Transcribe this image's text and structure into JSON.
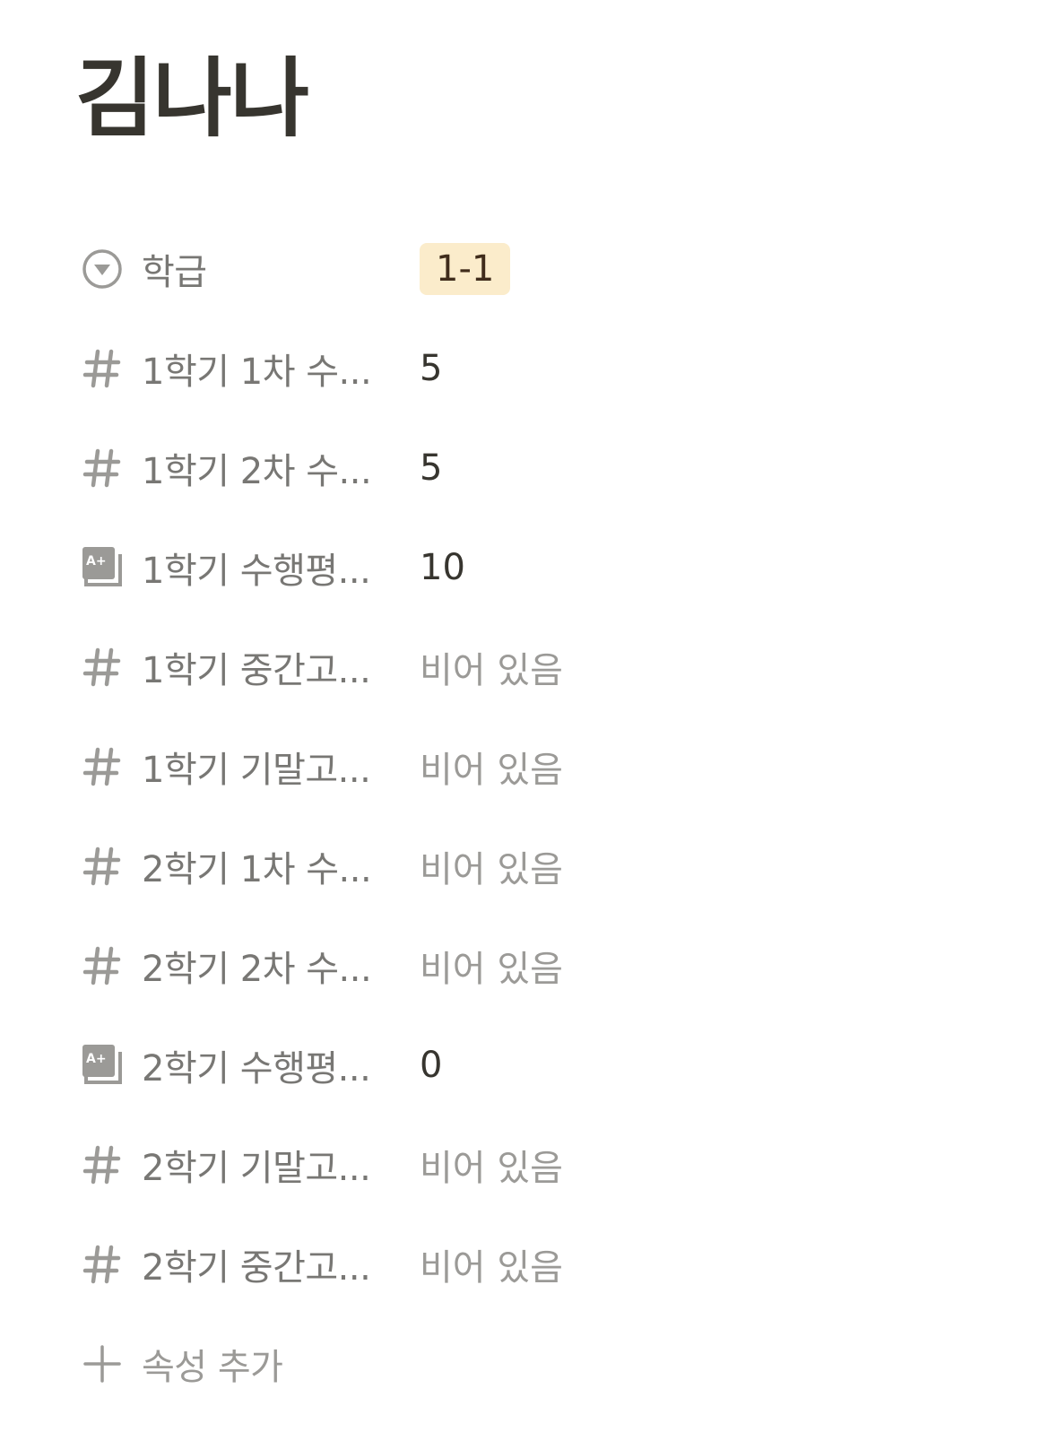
{
  "page": {
    "title": "김나나"
  },
  "properties": [
    {
      "icon": "select-icon",
      "name": "학급",
      "value": "1-1",
      "value_type": "tag",
      "tag_color": "#fbeccb"
    },
    {
      "icon": "number-icon",
      "name": "1학기 1차 수...",
      "value": "5",
      "value_type": "value"
    },
    {
      "icon": "number-icon",
      "name": "1학기 2차 수...",
      "value": "5",
      "value_type": "value"
    },
    {
      "icon": "grade-icon",
      "name": "1학기 수행평...",
      "value": "10",
      "value_type": "value"
    },
    {
      "icon": "number-icon",
      "name": "1학기 중간고...",
      "value": "비어 있음",
      "value_type": "empty"
    },
    {
      "icon": "number-icon",
      "name": "1학기 기말고...",
      "value": "비어 있음",
      "value_type": "empty"
    },
    {
      "icon": "number-icon",
      "name": "2학기 1차 수...",
      "value": "비어 있음",
      "value_type": "empty"
    },
    {
      "icon": "number-icon",
      "name": "2학기 2차 수...",
      "value": "비어 있음",
      "value_type": "empty"
    },
    {
      "icon": "grade-icon",
      "name": "2학기 수행평...",
      "value": "0",
      "value_type": "value"
    },
    {
      "icon": "number-icon",
      "name": "2학기 기말고...",
      "value": "비어 있음",
      "value_type": "empty"
    },
    {
      "icon": "number-icon",
      "name": "2학기 중간고...",
      "value": "비어 있음",
      "value_type": "empty"
    }
  ],
  "add_property": {
    "icon": "plus-icon",
    "label": "속성 추가"
  },
  "colors": {
    "text": "#37352f",
    "muted": "#787774",
    "empty": "#9b9a97",
    "icon": "#9b9a97"
  }
}
